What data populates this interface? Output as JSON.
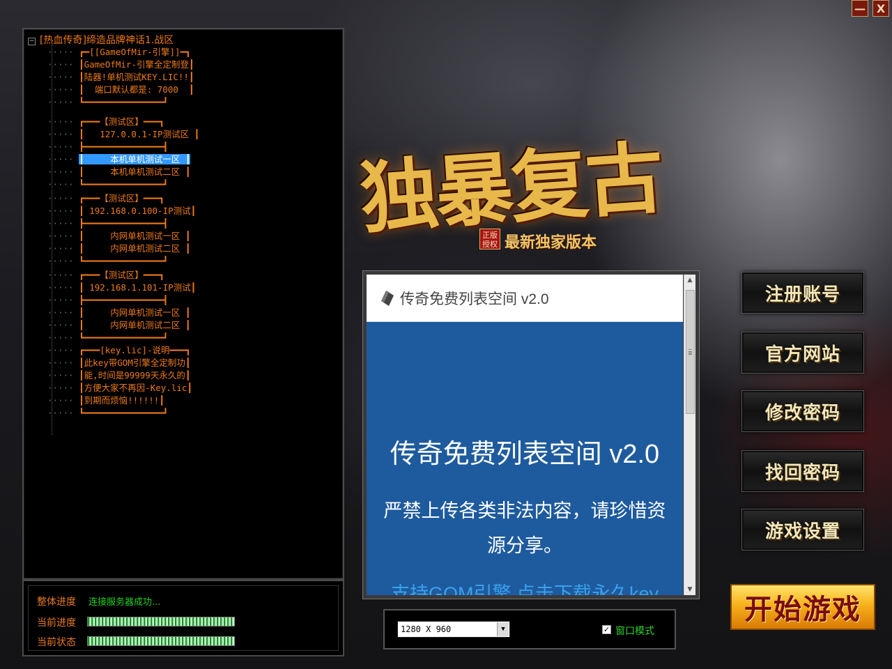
{
  "window_controls": {
    "minimize": "—",
    "close": "X"
  },
  "server_tree": {
    "root_toggle": "−",
    "root": "[热血传奇]缔造品牌神话1.战区",
    "items": [
      {
        "text": "┏━[[GameOfMir-引擎]]━┓",
        "selected": false
      },
      {
        "text": "┃GameOfMir-引擎全定制登┃",
        "selected": false
      },
      {
        "text": "┃陆器!单机测试KEY.LIC!!┃",
        "selected": false
      },
      {
        "text": "┃  端口默认都是: 7000  ┃",
        "selected": false
      },
      {
        "text": "┗━━━━━━━━━━━━━━━┛",
        "selected": false
      },
      {
        "text": "┏━━━【测试区】━━━┓",
        "selected": false
      },
      {
        "text": "┃   127.0.0.1-IP测试区 ┃",
        "selected": false
      },
      {
        "text": "┣━━━━━━━━━━━━━━━┫",
        "selected": false
      },
      {
        "text": "┃     本机单机测试一区 ┃",
        "selected": true
      },
      {
        "text": "┃     本机单机测试二区 ┃",
        "selected": false
      },
      {
        "text": "┗━━━━━━━━━━━━━━━┛",
        "selected": false
      },
      {
        "text": "┏━━━【测试区】━━━┓",
        "selected": false
      },
      {
        "text": "┃ 192.168.0.100-IP测试┃",
        "selected": false
      },
      {
        "text": "┣━━━━━━━━━━━━━━━┫",
        "selected": false
      },
      {
        "text": "┃     内网单机测试一区 ┃",
        "selected": false
      },
      {
        "text": "┃     内网单机测试二区 ┃",
        "selected": false
      },
      {
        "text": "┗━━━━━━━━━━━━━━━┛",
        "selected": false
      },
      {
        "text": "┏━━━【测试区】━━━┓",
        "selected": false
      },
      {
        "text": "┃ 192.168.1.101-IP测试┃",
        "selected": false
      },
      {
        "text": "┣━━━━━━━━━━━━━━━┫",
        "selected": false
      },
      {
        "text": "┃     内网单机测试一区 ┃",
        "selected": false
      },
      {
        "text": "┃     内网单机测试二区 ┃",
        "selected": false
      },
      {
        "text": "┗━━━━━━━━━━━━━━━┛",
        "selected": false
      },
      {
        "text": "┏━━━[key.lic]-说明━━━┓",
        "selected": false
      },
      {
        "text": "┃此key带GOM引擎全定制功┃",
        "selected": false
      },
      {
        "text": "┃能,时间是99999天永久的┃",
        "selected": false
      },
      {
        "text": "┃方便大家不再因-Key.lic┃",
        "selected": false
      },
      {
        "text": "┃到期而烦恼!!!!!!┃",
        "selected": false
      },
      {
        "text": "┗━━━━━━━━━━━━━━━┛",
        "selected": false
      }
    ]
  },
  "progress": {
    "overall_label": "整体进度",
    "overall_status": "连接服务器成功...",
    "current_progress_label": "当前进度",
    "current_progress_fill": 1.0,
    "current_status_label": "当前状态",
    "current_status_fill": 1.0
  },
  "logo": {
    "title": "独暴复古",
    "seal": "正版授权",
    "subtitle": "最新独家版本"
  },
  "browser": {
    "header_title": "传奇免费列表空间 v2.0",
    "heading": "传奇免费列表空间 v2.0",
    "paragraph": "严禁上传各类非法内容，请珍惜资源分享。",
    "link": "支持GOM引擎,点击下载永久key",
    "scroll_up": "▲",
    "scroll_down": "▼",
    "colors": {
      "body_bg": "#1e5b9e",
      "link": "#3aa1ee"
    }
  },
  "settings": {
    "resolution": "1280 X 960",
    "dropdown_arrow": "▼",
    "windowed_checked": true,
    "checkmark": "✓",
    "windowed_label": "窗口模式"
  },
  "menu": {
    "register": "注册账号",
    "website": "官方网站",
    "change_password": "修改密码",
    "recover_password": "找回密码",
    "game_settings": "游戏设置",
    "start_game": "开始游戏"
  },
  "colors": {
    "tree_text": "#ee7a18",
    "selection": "#3399ff",
    "status_green": "#22d322",
    "start_button": "#f7b21c"
  }
}
